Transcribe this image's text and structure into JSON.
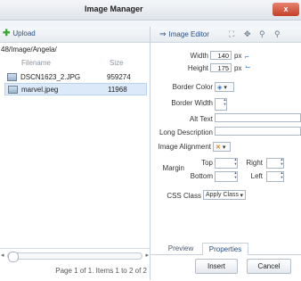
{
  "window": {
    "title": "Image Manager",
    "close_label": "x"
  },
  "left": {
    "upload_label": "Upload",
    "path": "48/Image/Angela/",
    "headers": {
      "filename": "Filename",
      "size": "Size"
    },
    "files": [
      {
        "name": "DSCN1623_2.JPG",
        "size": "959274"
      },
      {
        "name": "marvel.jpeg",
        "size": "11968"
      }
    ],
    "pager_text": "Page 1 of 1. Items 1 to 2 of 2"
  },
  "right": {
    "editor_label": "Image Editor",
    "width": {
      "label": "Width",
      "value": "140",
      "unit": "px"
    },
    "height": {
      "label": "Height",
      "value": "175",
      "unit": "px"
    },
    "border_color_label": "Border Color",
    "border_width_label": "Border Width",
    "alt_text_label": "Alt Text",
    "long_desc_label": "Long Description",
    "image_alignment_label": "Image Alignment",
    "margin": {
      "label": "Margin",
      "top_label": "Top",
      "bottom_label": "Bottom",
      "right_label": "Right",
      "left_label": "Left"
    },
    "css_class_label": "CSS Class",
    "css_class_value": "Apply Class",
    "tabs": [
      "Preview",
      "Properties"
    ],
    "insert_label": "Insert",
    "cancel_label": "Cancel"
  }
}
